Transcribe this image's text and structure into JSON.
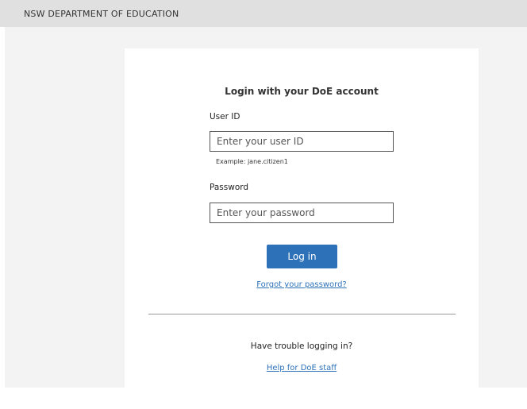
{
  "header": {
    "org_name": "NSW DEPARTMENT OF EDUCATION"
  },
  "login": {
    "title": "Login with your DoE account",
    "user_id_label": "User ID",
    "user_id_placeholder": "Enter your user ID",
    "user_id_value": "",
    "user_id_hint": "Example: jane.citizen1",
    "password_label": "Password",
    "password_placeholder": "Enter your password",
    "password_value": "",
    "login_button": "Log in",
    "forgot_password_link": "Forgot your password?"
  },
  "help": {
    "trouble_text": "Have trouble logging in?",
    "help_link": "Help for DoE staff"
  },
  "colors": {
    "accent": "#2d72b8",
    "header_bg": "#e0e0e0",
    "page_bg": "#f3f3f3"
  }
}
